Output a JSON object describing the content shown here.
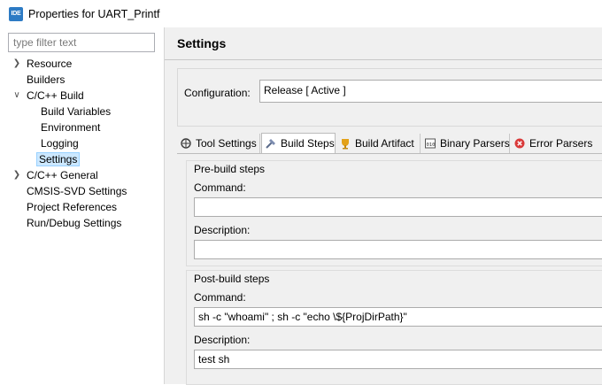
{
  "window": {
    "icon_text": "IDE",
    "title": "Properties for UART_Printf"
  },
  "filter": {
    "placeholder": "type filter text"
  },
  "tree": {
    "items": [
      {
        "label": "Resource",
        "expandable": true,
        "expanded": false
      },
      {
        "label": "Builders"
      },
      {
        "label": "C/C++ Build",
        "expandable": true,
        "expanded": true
      },
      {
        "label": "Build Variables"
      },
      {
        "label": "Environment"
      },
      {
        "label": "Logging"
      },
      {
        "label": "Settings",
        "selected": true
      },
      {
        "label": "C/C++ General",
        "expandable": true,
        "expanded": false
      },
      {
        "label": "CMSIS-SVD Settings"
      },
      {
        "label": "Project References"
      },
      {
        "label": "Run/Debug Settings"
      }
    ]
  },
  "page": {
    "title": "Settings"
  },
  "configuration": {
    "label": "Configuration:",
    "value": "Release  [ Active ]"
  },
  "tabs": [
    {
      "label": "Tool Settings",
      "icon": "tool-settings-icon"
    },
    {
      "label": "Build Steps",
      "icon": "build-steps-icon",
      "active": true
    },
    {
      "label": "Build Artifact",
      "icon": "build-artifact-icon"
    },
    {
      "label": "Binary Parsers",
      "icon": "binary-parsers-icon"
    },
    {
      "label": "Error Parsers",
      "icon": "error-parsers-icon"
    }
  ],
  "prebuild": {
    "title": "Pre-build steps",
    "command_label": "Command:",
    "command_value": "",
    "description_label": "Description:",
    "description_value": ""
  },
  "postbuild": {
    "title": "Post-build steps",
    "command_label": "Command:",
    "command_value": "sh -c \"whoami\" ; sh -c \"echo \\${ProjDirPath}\"",
    "description_label": "Description:",
    "description_value": "test sh"
  }
}
